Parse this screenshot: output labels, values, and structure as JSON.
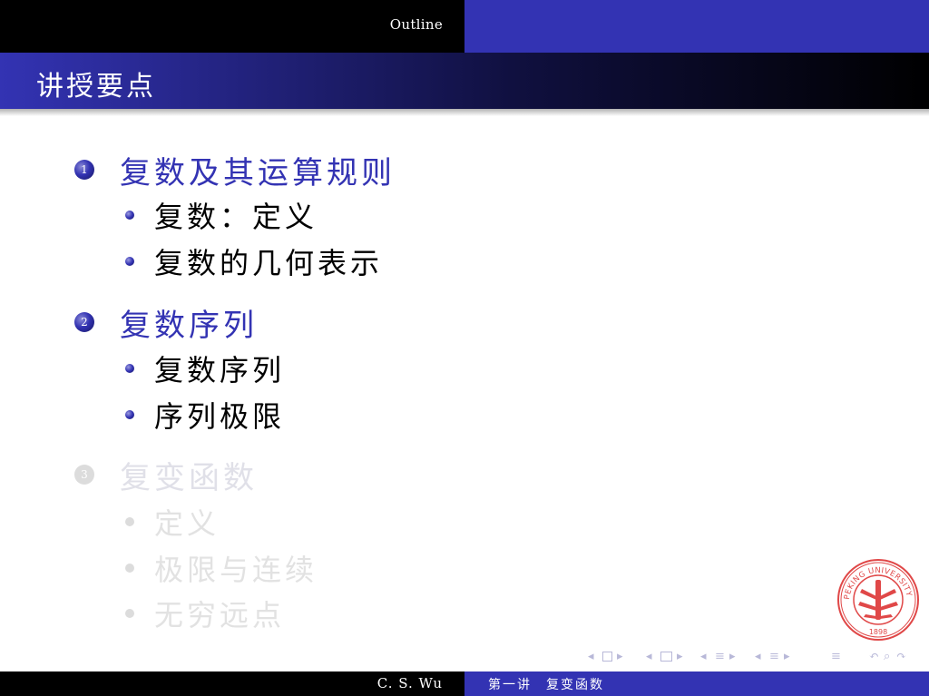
{
  "header": {
    "outline_label": "Outline"
  },
  "frame": {
    "title": "讲授要点"
  },
  "sections": [
    {
      "number": "1",
      "title": "复数及其运算规则",
      "items": [
        "复数：定义",
        "复数的几何表示"
      ]
    },
    {
      "number": "2",
      "title": "复数序列",
      "items": [
        "复数序列",
        "序列极限"
      ]
    },
    {
      "number": "3",
      "title": "复变函数",
      "items": [
        "定义",
        "极限与连续",
        "无穷远点"
      ]
    }
  ],
  "logo": {
    "text": "PEKING UNIVERSITY",
    "year": "1898"
  },
  "footer": {
    "author": "C. S. Wu",
    "lecture": "第一讲　复变函数"
  },
  "colors": {
    "beamer_blue": "#3333b3",
    "black": "#000000",
    "logo_red": "#e04848"
  }
}
